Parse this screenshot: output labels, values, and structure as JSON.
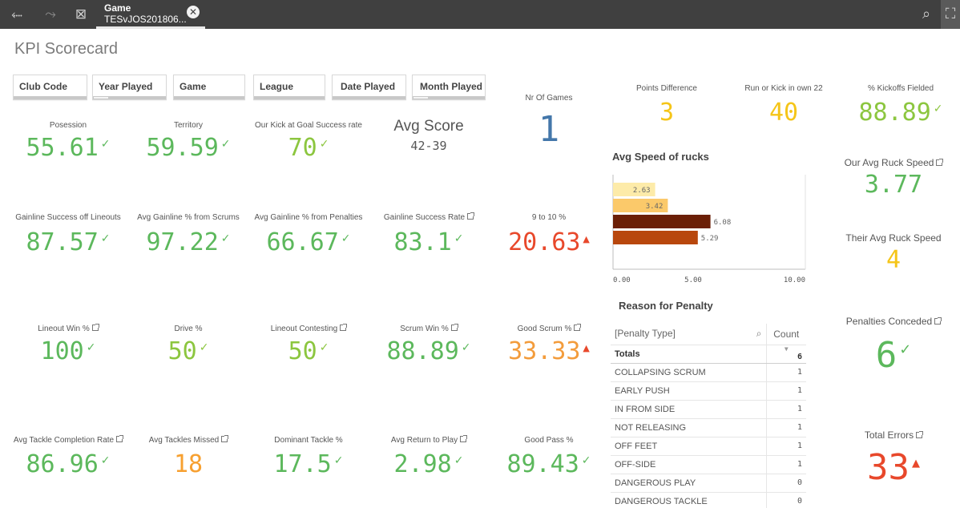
{
  "toolbar": {
    "tab_title": "Game",
    "tab_subtitle": "TESvJOS201806...",
    "icons": [
      "back-icon",
      "forward-icon",
      "clear-selections-icon",
      "close-icon",
      "search-icon",
      "smart-search-icon"
    ]
  },
  "page_title": "KPI Scorecard",
  "filters": [
    "Club Code",
    "Year Played",
    "Game",
    "League",
    "Date Played",
    "Month Played"
  ],
  "colors": {
    "green": "#5cb85c",
    "lightgreen": "#8cc63f",
    "orange": "#f7a030",
    "yellow": "#f5c518",
    "red": "#e8482b",
    "blue": "#4477aa"
  },
  "kpis": {
    "posession": {
      "label": "Posession",
      "value": "55.61",
      "indicator": "✓"
    },
    "territory": {
      "label": "Territory",
      "value": "59.59",
      "indicator": "✓"
    },
    "kick_goal": {
      "label": "Our Kick at Goal Success rate",
      "value": "70",
      "indicator": "✓"
    },
    "avg_score": {
      "label": "Avg Score",
      "value": "42-39"
    },
    "nr_games": {
      "label": "Nr Of Games",
      "value": "1"
    },
    "gainline_lineouts": {
      "label": "Gainline Success off Lineouts",
      "value": "87.57",
      "indicator": "✓"
    },
    "gainline_scrums": {
      "label": "Avg Gainline % from Scrums",
      "value": "97.22",
      "indicator": "✓"
    },
    "gainline_penalties": {
      "label": "Avg Gainline % from Penalties",
      "value": "66.67",
      "indicator": "✓"
    },
    "gainline_rate": {
      "label": "Gainline Success Rate",
      "value": "83.1",
      "indicator": "✓"
    },
    "nine_to_ten": {
      "label": "9 to 10 %",
      "value": "20.63",
      "indicator": "▲"
    },
    "lineout_win": {
      "label": "Lineout Win %",
      "value": "100",
      "indicator": "✓"
    },
    "drive": {
      "label": "Drive %",
      "value": "50",
      "indicator": "✓"
    },
    "lineout_contesting": {
      "label": "Lineout Contesting",
      "value": "50",
      "indicator": "✓"
    },
    "scrum_win": {
      "label": "Scrum Win %",
      "value": "88.89",
      "indicator": "✓"
    },
    "good_scrum": {
      "label": "Good Scrum %",
      "value": "33.33",
      "indicator": "▲"
    },
    "tackle_completion": {
      "label": "Avg Tackle Completion Rate",
      "value": "86.96",
      "indicator": "✓"
    },
    "tackles_missed": {
      "label": "Avg Tackles Missed",
      "value": "18"
    },
    "dominant_tackle": {
      "label": "Dominant Tackle %",
      "value": "17.5",
      "indicator": "✓"
    },
    "return_to_play": {
      "label": "Avg Return to Play",
      "value": "2.98",
      "indicator": "✓"
    },
    "good_pass": {
      "label": "Good Pass %",
      "value": "89.43",
      "indicator": "✓"
    },
    "points_diff": {
      "label": "Points Difference",
      "value": "3"
    },
    "run_or_kick": {
      "label": "Run or Kick in own 22",
      "value": "40"
    },
    "kickoffs_fielded": {
      "label": "% Kickoffs Fielded",
      "value": "88.89",
      "indicator": "✓"
    },
    "our_ruck_speed": {
      "label": "Our Avg Ruck Speed",
      "value": "3.77"
    },
    "their_ruck_speed": {
      "label": "Their Avg Ruck Speed",
      "value": "4"
    },
    "penalties_conceded": {
      "label": "Penalties Conceded",
      "value": "6",
      "indicator": "✓"
    },
    "total_errors": {
      "label": "Total Errors",
      "value": "33",
      "indicator": "▲"
    }
  },
  "chart_data": {
    "type": "bar",
    "orientation": "horizontal",
    "title": "Avg Speed of rucks",
    "values": [
      2.63,
      3.42,
      6.08,
      5.29
    ],
    "value_labels": [
      "2.63",
      "3.42",
      "6.08",
      "5.29"
    ],
    "colors": [
      "#fdeba9",
      "#fbc96a",
      "#6b1f06",
      "#b8470d"
    ],
    "xlim": [
      0,
      12
    ],
    "x_ticks": [
      0,
      5,
      10
    ],
    "x_tick_labels": [
      "0.00",
      "5.00",
      "10.00"
    ]
  },
  "penalty_table": {
    "title": "Reason for Penalty",
    "col_type": "[Penalty Type]",
    "col_count": "Count",
    "totals_label": "Totals",
    "totals_value": "6",
    "rows": [
      {
        "type": "COLLAPSING SCRUM",
        "count": "1"
      },
      {
        "type": "EARLY PUSH",
        "count": "1"
      },
      {
        "type": "IN FROM SIDE",
        "count": "1"
      },
      {
        "type": "NOT RELEASING",
        "count": "1"
      },
      {
        "type": "OFF FEET",
        "count": "1"
      },
      {
        "type": "OFF-SIDE",
        "count": "1"
      },
      {
        "type": "DANGEROUS PLAY",
        "count": "0"
      },
      {
        "type": "DANGEROUS TACKLE",
        "count": "0"
      }
    ]
  }
}
